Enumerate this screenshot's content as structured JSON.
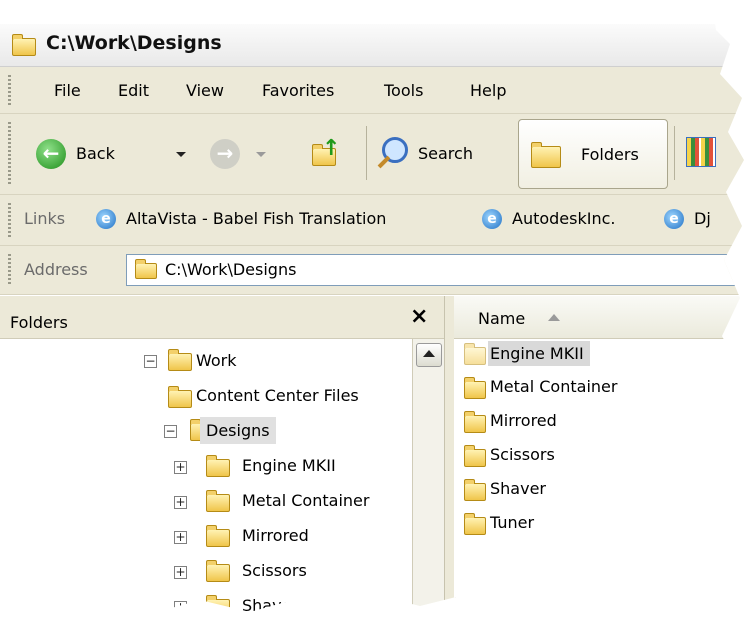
{
  "window": {
    "title": "C:\\Work\\Designs"
  },
  "menu": [
    "File",
    "Edit",
    "View",
    "Favorites",
    "Tools",
    "Help"
  ],
  "toolbar": {
    "back": "Back",
    "search": "Search",
    "folders": "Folders"
  },
  "links": {
    "label": "Links",
    "items": [
      "AltaVista - Babel Fish Translation",
      "AutodeskInc.",
      "Dj"
    ]
  },
  "address": {
    "label": "Address",
    "value": "C:\\Work\\Designs"
  },
  "folders_pane": {
    "title": "Folders",
    "close": "×",
    "tree": [
      {
        "label": "Work",
        "expander": "−"
      },
      {
        "label": "Content Center Files",
        "expander": ""
      },
      {
        "label": "Designs",
        "expander": "−"
      },
      {
        "label": "Engine MKII",
        "expander": "+"
      },
      {
        "label": "Metal Container",
        "expander": "+"
      },
      {
        "label": "Mirrored",
        "expander": "+"
      },
      {
        "label": "Scissors",
        "expander": "+"
      },
      {
        "label": "Shaver",
        "expander": "+"
      }
    ]
  },
  "file_list": {
    "column_name": "Name",
    "items": [
      "Engine MKII",
      "Metal Container",
      "Mirrored",
      "Scissors",
      "Shaver",
      "Tuner"
    ]
  }
}
